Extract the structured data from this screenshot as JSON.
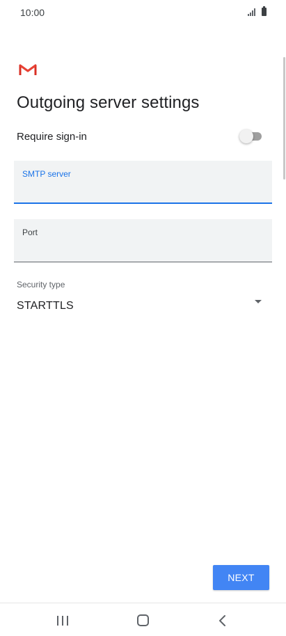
{
  "status_bar": {
    "time": "10:00",
    "icons": [
      "signal-icon",
      "battery-icon"
    ]
  },
  "header": {
    "logo": "gmail-logo",
    "title": "Outgoing server settings"
  },
  "require_signin": {
    "label": "Require sign-in",
    "enabled": false
  },
  "smtp_server": {
    "label": "SMTP server",
    "value": "",
    "focused": true
  },
  "port": {
    "label": "Port",
    "value": ""
  },
  "security_type": {
    "label": "Security type",
    "value": "STARTTLS"
  },
  "actions": {
    "next_label": "NEXT"
  },
  "nav_bar": {
    "icons": [
      "recents-icon",
      "home-icon",
      "back-icon"
    ]
  },
  "colors": {
    "accent": "#1a73e8",
    "button": "#4285f4",
    "field_bg": "#f1f3f4",
    "gmail_red": "#d93025"
  }
}
